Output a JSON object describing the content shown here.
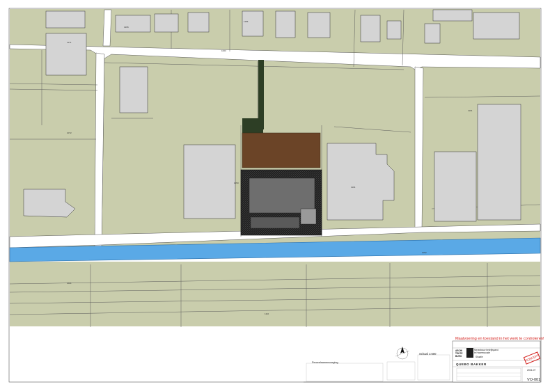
{
  "drawing": {
    "warning_text": "Maatvoering en toestand in het werk te controleren!",
    "scale": "Schaal 1:500",
    "section_heading": "Perceelsamenvoeging",
    "project_title": "Nieuwbouw bedrijfspand",
    "project_sub": "te Hazerswoude",
    "firm_name": "QUEBO BAKKER",
    "logo_text": "ARCHI TEKTE BURO",
    "status_stamp": "CONCEPT",
    "date": "2021-07",
    "sheet_number": "VO-001",
    "status_label": "Situatie",
    "colors": {
      "ground": "#c9cdac",
      "road": "#ffffff",
      "building_light": "#d4d4d4",
      "building_dark": "#6e6e6e",
      "dark_hatch": "#2b2b2b",
      "water": "#5aa9e6",
      "brown_plot": "#6b4427",
      "green_strip": "#2d3e25",
      "line": "#444444",
      "warning": "#d4201c"
    }
  }
}
